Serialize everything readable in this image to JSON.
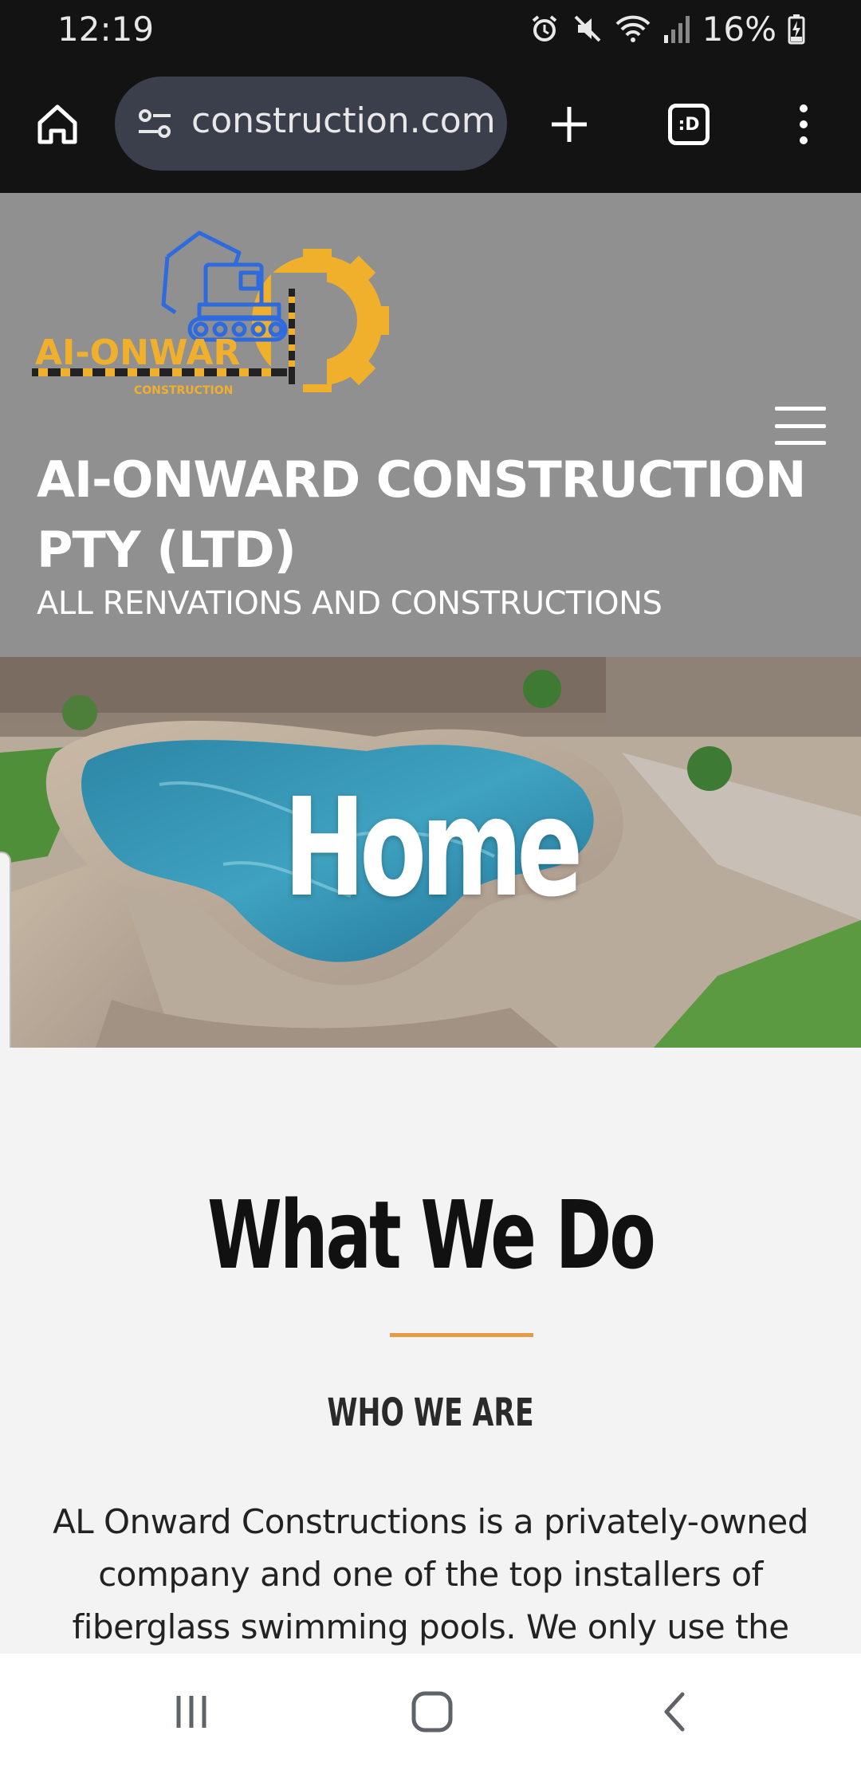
{
  "status_bar": {
    "time": "12:19",
    "battery": "16%",
    "icons": [
      "alarm-icon",
      "mute-icon",
      "wifi-icon",
      "signal-icon",
      "battery-charging-icon"
    ]
  },
  "browser": {
    "url": "construction.com",
    "tab_count": ":D",
    "icons": [
      "home-icon",
      "site-info-icon",
      "new-tab-icon",
      "tab-switcher-icon",
      "more-menu-icon"
    ]
  },
  "site": {
    "logo": {
      "wordmark": "AI-ONWAR",
      "sub": "CONSTRUCTION"
    },
    "title": "AI-ONWARD CONSTRUCTION PTY (LTD)",
    "tagline": "ALL RENVATIONS AND CONSTRUCTIONS",
    "header_bg": "#909090"
  },
  "hero": {
    "title": "Home"
  },
  "content": {
    "heading": "What We Do",
    "subheading": "WHO WE ARE",
    "body": "AL Onward Constructions is a privately-owned company and one of the top installers of fiberglass swimming pools. We only use the",
    "accent": "#e79a45"
  },
  "nav_bar": {
    "icons": [
      "recent-apps-icon",
      "home-nav-icon",
      "back-icon"
    ]
  }
}
